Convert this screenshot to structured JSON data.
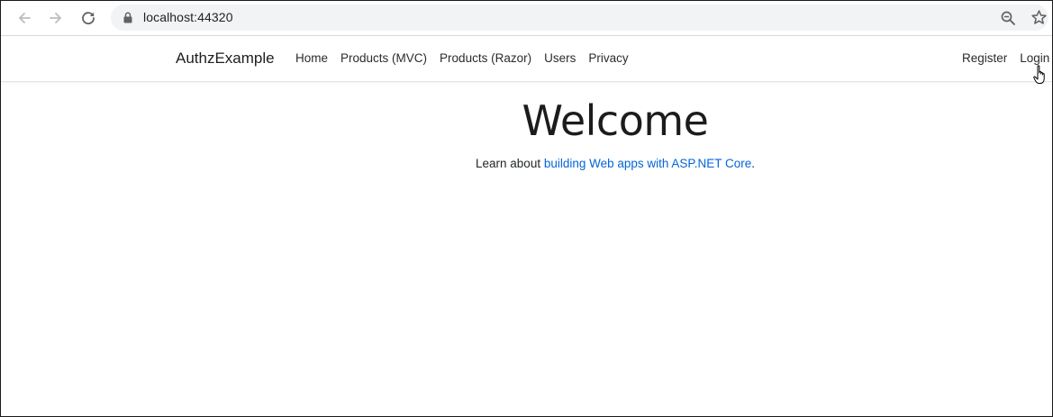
{
  "browser": {
    "url": "localhost:44320",
    "icons": {
      "back": "arrow-left-icon",
      "forward": "arrow-right-icon",
      "reload": "reload-icon",
      "lock": "lock-icon",
      "zoom": "zoom-icon",
      "bookmark": "star-icon"
    }
  },
  "navbar": {
    "brand": "AuthzExample",
    "links": [
      {
        "label": "Home"
      },
      {
        "label": "Products (MVC)"
      },
      {
        "label": "Products (Razor)"
      },
      {
        "label": "Users"
      },
      {
        "label": "Privacy"
      }
    ],
    "right_links": [
      {
        "label": "Register"
      },
      {
        "label": "Login"
      }
    ]
  },
  "main": {
    "title": "Welcome",
    "intro_prefix": "Learn about ",
    "intro_link": "building Web apps with ASP.NET Core",
    "intro_suffix": "."
  },
  "colors": {
    "link": "#0366d6",
    "omnibox_bg": "#f1f3f4",
    "text": "#212529"
  }
}
